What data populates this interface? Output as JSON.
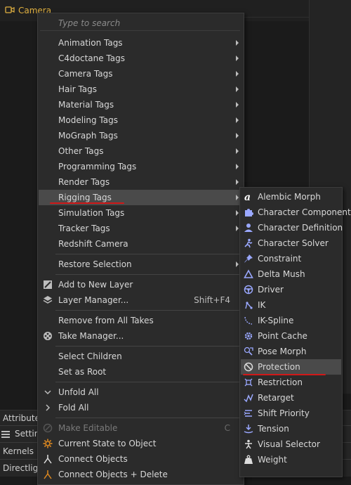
{
  "app": {
    "object_label": "Camera",
    "bottom_panel": {
      "attributes": "Attributes",
      "settings": "Settings",
      "kernels": "Kernels",
      "directlight": "Directlight"
    }
  },
  "menu": {
    "search_placeholder": "Type to search",
    "tag_items": [
      "Animation Tags",
      "C4doctane Tags",
      "Camera Tags",
      "Hair Tags",
      "Material Tags",
      "Modeling Tags",
      "MoGraph Tags",
      "Other Tags",
      "Programming Tags",
      "Render Tags",
      "Rigging Tags",
      "Simulation Tags",
      "Tracker Tags",
      "Redshift Camera"
    ],
    "restore_selection": "Restore Selection",
    "add_to_new_layer": "Add to New Layer",
    "layer_manager": "Layer Manager...",
    "layer_manager_shortcut": "Shift+F4",
    "remove_from_all_takes": "Remove from All Takes",
    "take_manager": "Take Manager...",
    "select_children": "Select Children",
    "set_as_root": "Set as Root",
    "unfold_all": "Unfold All",
    "fold_all": "Fold All",
    "make_editable": "Make Editable",
    "make_editable_shortcut": "C",
    "current_state_to_object": "Current State to Object",
    "connect_objects": "Connect Objects",
    "connect_objects_delete": "Connect Objects + Delete"
  },
  "submenu": {
    "items": [
      {
        "label": "Alembic Morph",
        "icon": "alembic-icon"
      },
      {
        "label": "Character Component",
        "icon": "puzzle-icon"
      },
      {
        "label": "Character Definition",
        "icon": "person-icon"
      },
      {
        "label": "Character Solver",
        "icon": "running-figure-icon"
      },
      {
        "label": "Constraint",
        "icon": "pin-icon"
      },
      {
        "label": "Delta Mush",
        "icon": "triangle-icon"
      },
      {
        "label": "Driver",
        "icon": "steering-wheel-icon"
      },
      {
        "label": "IK",
        "icon": "ik-chain-icon"
      },
      {
        "label": "IK-Spline",
        "icon": "ik-spline-icon"
      },
      {
        "label": "Point Cache",
        "icon": "gear-icon"
      },
      {
        "label": "Pose Morph",
        "icon": "pose-morph-icon"
      },
      {
        "label": "Protection",
        "icon": "no-entry-icon"
      },
      {
        "label": "Restriction",
        "icon": "restriction-icon"
      },
      {
        "label": "Retarget",
        "icon": "retarget-icon"
      },
      {
        "label": "Shift Priority",
        "icon": "priority-icon"
      },
      {
        "label": "Tension",
        "icon": "tension-icon"
      },
      {
        "label": "Visual Selector",
        "icon": "figure-icon"
      },
      {
        "label": "Weight",
        "icon": "weight-icon"
      }
    ]
  },
  "colors": {
    "menu_bg": "#2b2b2b",
    "highlight": "#4a4a4a",
    "annotation_red": "#d01818",
    "tag_icon_blue": "#9aa8ff",
    "object_label": "#e0b040"
  }
}
